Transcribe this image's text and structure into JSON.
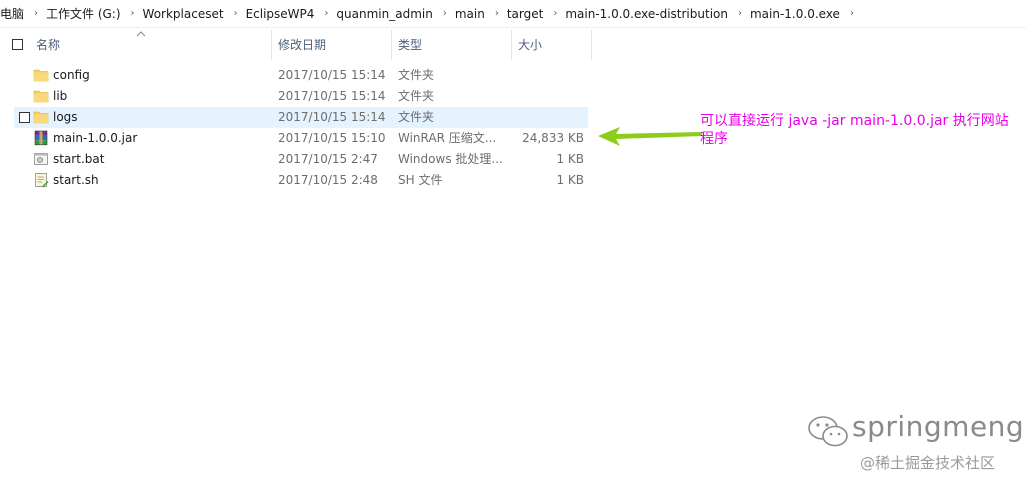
{
  "breadcrumb": [
    "电脑",
    "工作文件 (G:)",
    "Workplaceset",
    "EclipseWP4",
    "quanmin_admin",
    "main",
    "target",
    "main-1.0.0.exe-distribution",
    "main-1.0.0.exe"
  ],
  "breadcrumb_separator": "›",
  "columns": {
    "name": "名称",
    "date": "修改日期",
    "type": "类型",
    "size": "大小"
  },
  "files": [
    {
      "name": "config",
      "date": "2017/10/15 15:14",
      "type": "文件夹",
      "size": "",
      "icon": "folder-icon"
    },
    {
      "name": "lib",
      "date": "2017/10/15 15:14",
      "type": "文件夹",
      "size": "",
      "icon": "folder-icon"
    },
    {
      "name": "logs",
      "date": "2017/10/15 15:14",
      "type": "文件夹",
      "size": "",
      "icon": "folder-icon"
    },
    {
      "name": "main-1.0.0.jar",
      "date": "2017/10/15 15:10",
      "type": "WinRAR 压缩文...",
      "size": "24,833 KB",
      "icon": "winrar-archive-icon"
    },
    {
      "name": "start.bat",
      "date": "2017/10/15 2:47",
      "type": "Windows 批处理...",
      "size": "1 KB",
      "icon": "batch-file-icon"
    },
    {
      "name": "start.sh",
      "date": "2017/10/15 2:48",
      "type": "SH 文件",
      "size": "1 KB",
      "icon": "shell-script-icon"
    }
  ],
  "annotation": {
    "text": "可以直接运行 java -jar main-1.0.0.jar 执行网站程序",
    "color": "#e800e8",
    "arrow_color": "#8ccc1a"
  },
  "watermark": {
    "name": "springmeng",
    "site": "@稀土掘金技术社区"
  },
  "colors": {
    "header_text": "#4c607a",
    "hover_row": "#e5f3ff",
    "folder": "#f5cf6a"
  }
}
